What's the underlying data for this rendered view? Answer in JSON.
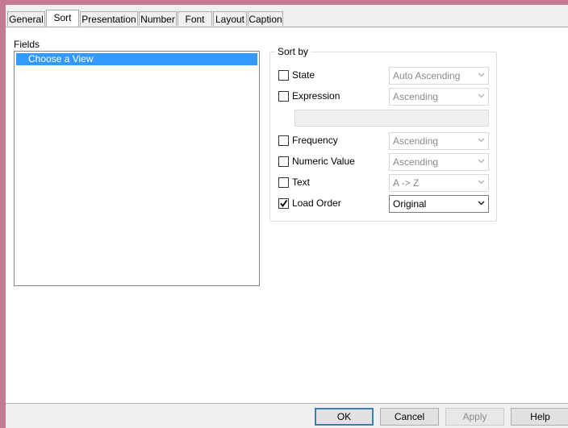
{
  "tabs": [
    "General",
    "Sort",
    "Presentation",
    "Number",
    "Font",
    "Layout",
    "Caption"
  ],
  "active_tab": "Sort",
  "fields": {
    "label": "Fields",
    "items": [
      "Choose a View"
    ]
  },
  "sort_by": {
    "title": "Sort by",
    "options": [
      {
        "label": "State",
        "checked": false,
        "combo": "Auto Ascending",
        "enabled": false
      },
      {
        "label": "Expression",
        "checked": false,
        "combo": "Ascending",
        "enabled": false
      },
      {
        "label": "Frequency",
        "checked": false,
        "combo": "Ascending",
        "enabled": false
      },
      {
        "label": "Numeric Value",
        "checked": false,
        "combo": "Ascending",
        "enabled": false
      },
      {
        "label": "Text",
        "checked": false,
        "combo": "A -> Z",
        "enabled": false
      },
      {
        "label": "Load Order",
        "checked": true,
        "combo": "Original",
        "enabled": true
      }
    ]
  },
  "buttons": {
    "ok": "OK",
    "cancel": "Cancel",
    "apply": "Apply",
    "help": "Help"
  },
  "colors": {
    "selection": "#3399ff",
    "window_frame": "#c47a94"
  }
}
